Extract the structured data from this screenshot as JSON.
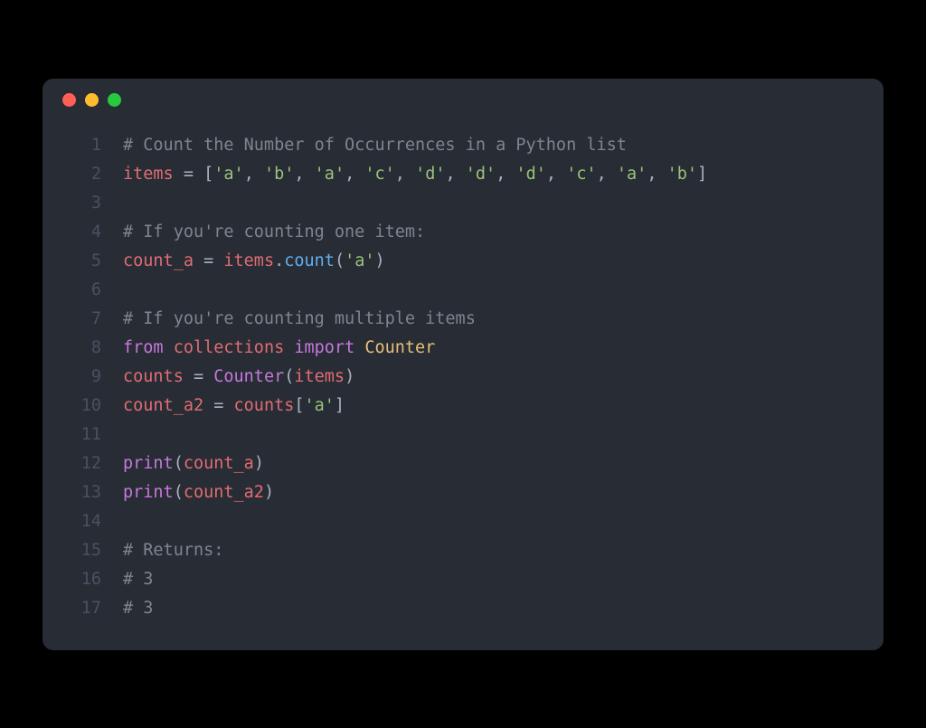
{
  "window": {
    "dots": [
      "red",
      "yellow",
      "green"
    ]
  },
  "code": {
    "lines": [
      {
        "n": "1",
        "tokens": [
          {
            "t": "# Count the Number of Occurrences in a Python list",
            "c": "c-comment"
          }
        ]
      },
      {
        "n": "2",
        "tokens": [
          {
            "t": "items",
            "c": "c-ident"
          },
          {
            "t": " ",
            "c": "c-plain"
          },
          {
            "t": "=",
            "c": "c-op"
          },
          {
            "t": " ",
            "c": "c-plain"
          },
          {
            "t": "[",
            "c": "c-punct"
          },
          {
            "t": "'a'",
            "c": "c-str"
          },
          {
            "t": ", ",
            "c": "c-punct"
          },
          {
            "t": "'b'",
            "c": "c-str"
          },
          {
            "t": ", ",
            "c": "c-punct"
          },
          {
            "t": "'a'",
            "c": "c-str"
          },
          {
            "t": ", ",
            "c": "c-punct"
          },
          {
            "t": "'c'",
            "c": "c-str"
          },
          {
            "t": ", ",
            "c": "c-punct"
          },
          {
            "t": "'d'",
            "c": "c-str"
          },
          {
            "t": ", ",
            "c": "c-punct"
          },
          {
            "t": "'d'",
            "c": "c-str"
          },
          {
            "t": ", ",
            "c": "c-punct"
          },
          {
            "t": "'d'",
            "c": "c-str"
          },
          {
            "t": ", ",
            "c": "c-punct"
          },
          {
            "t": "'c'",
            "c": "c-str"
          },
          {
            "t": ", ",
            "c": "c-punct"
          },
          {
            "t": "'a'",
            "c": "c-str"
          },
          {
            "t": ", ",
            "c": "c-punct"
          },
          {
            "t": "'b'",
            "c": "c-str"
          },
          {
            "t": "]",
            "c": "c-punct"
          }
        ]
      },
      {
        "n": "3",
        "tokens": []
      },
      {
        "n": "4",
        "tokens": [
          {
            "t": "# If you're counting one item:",
            "c": "c-comment"
          }
        ]
      },
      {
        "n": "5",
        "tokens": [
          {
            "t": "count_a",
            "c": "c-ident"
          },
          {
            "t": " ",
            "c": "c-plain"
          },
          {
            "t": "=",
            "c": "c-op"
          },
          {
            "t": " ",
            "c": "c-plain"
          },
          {
            "t": "items",
            "c": "c-ident"
          },
          {
            "t": ".",
            "c": "c-punct"
          },
          {
            "t": "count",
            "c": "c-func"
          },
          {
            "t": "(",
            "c": "c-punct"
          },
          {
            "t": "'a'",
            "c": "c-str"
          },
          {
            "t": ")",
            "c": "c-punct"
          }
        ]
      },
      {
        "n": "6",
        "tokens": []
      },
      {
        "n": "7",
        "tokens": [
          {
            "t": "# If you're counting multiple items",
            "c": "c-comment"
          }
        ]
      },
      {
        "n": "8",
        "tokens": [
          {
            "t": "from",
            "c": "c-kw"
          },
          {
            "t": " ",
            "c": "c-plain"
          },
          {
            "t": "collections",
            "c": "c-ident"
          },
          {
            "t": " ",
            "c": "c-plain"
          },
          {
            "t": "import",
            "c": "c-kw"
          },
          {
            "t": " ",
            "c": "c-plain"
          },
          {
            "t": "Counter",
            "c": "c-builtin"
          }
        ]
      },
      {
        "n": "9",
        "tokens": [
          {
            "t": "counts",
            "c": "c-ident"
          },
          {
            "t": " ",
            "c": "c-plain"
          },
          {
            "t": "=",
            "c": "c-op"
          },
          {
            "t": " ",
            "c": "c-plain"
          },
          {
            "t": "Counter",
            "c": "c-funcpur"
          },
          {
            "t": "(",
            "c": "c-punct"
          },
          {
            "t": "items",
            "c": "c-ident"
          },
          {
            "t": ")",
            "c": "c-punct"
          }
        ]
      },
      {
        "n": "10",
        "tokens": [
          {
            "t": "count_a2",
            "c": "c-ident"
          },
          {
            "t": " ",
            "c": "c-plain"
          },
          {
            "t": "=",
            "c": "c-op"
          },
          {
            "t": " ",
            "c": "c-plain"
          },
          {
            "t": "counts",
            "c": "c-ident"
          },
          {
            "t": "[",
            "c": "c-punct"
          },
          {
            "t": "'a'",
            "c": "c-str"
          },
          {
            "t": "]",
            "c": "c-punct"
          }
        ]
      },
      {
        "n": "11",
        "tokens": []
      },
      {
        "n": "12",
        "tokens": [
          {
            "t": "print",
            "c": "c-funcpur"
          },
          {
            "t": "(",
            "c": "c-punct"
          },
          {
            "t": "count_a",
            "c": "c-ident"
          },
          {
            "t": ")",
            "c": "c-punct"
          }
        ]
      },
      {
        "n": "13",
        "tokens": [
          {
            "t": "print",
            "c": "c-funcpur"
          },
          {
            "t": "(",
            "c": "c-punct"
          },
          {
            "t": "count_a2",
            "c": "c-ident"
          },
          {
            "t": ")",
            "c": "c-punct"
          }
        ]
      },
      {
        "n": "14",
        "tokens": []
      },
      {
        "n": "15",
        "tokens": [
          {
            "t": "# Returns:",
            "c": "c-comment"
          }
        ]
      },
      {
        "n": "16",
        "tokens": [
          {
            "t": "# 3",
            "c": "c-comment"
          }
        ]
      },
      {
        "n": "17",
        "tokens": [
          {
            "t": "# 3",
            "c": "c-comment"
          }
        ]
      }
    ]
  }
}
